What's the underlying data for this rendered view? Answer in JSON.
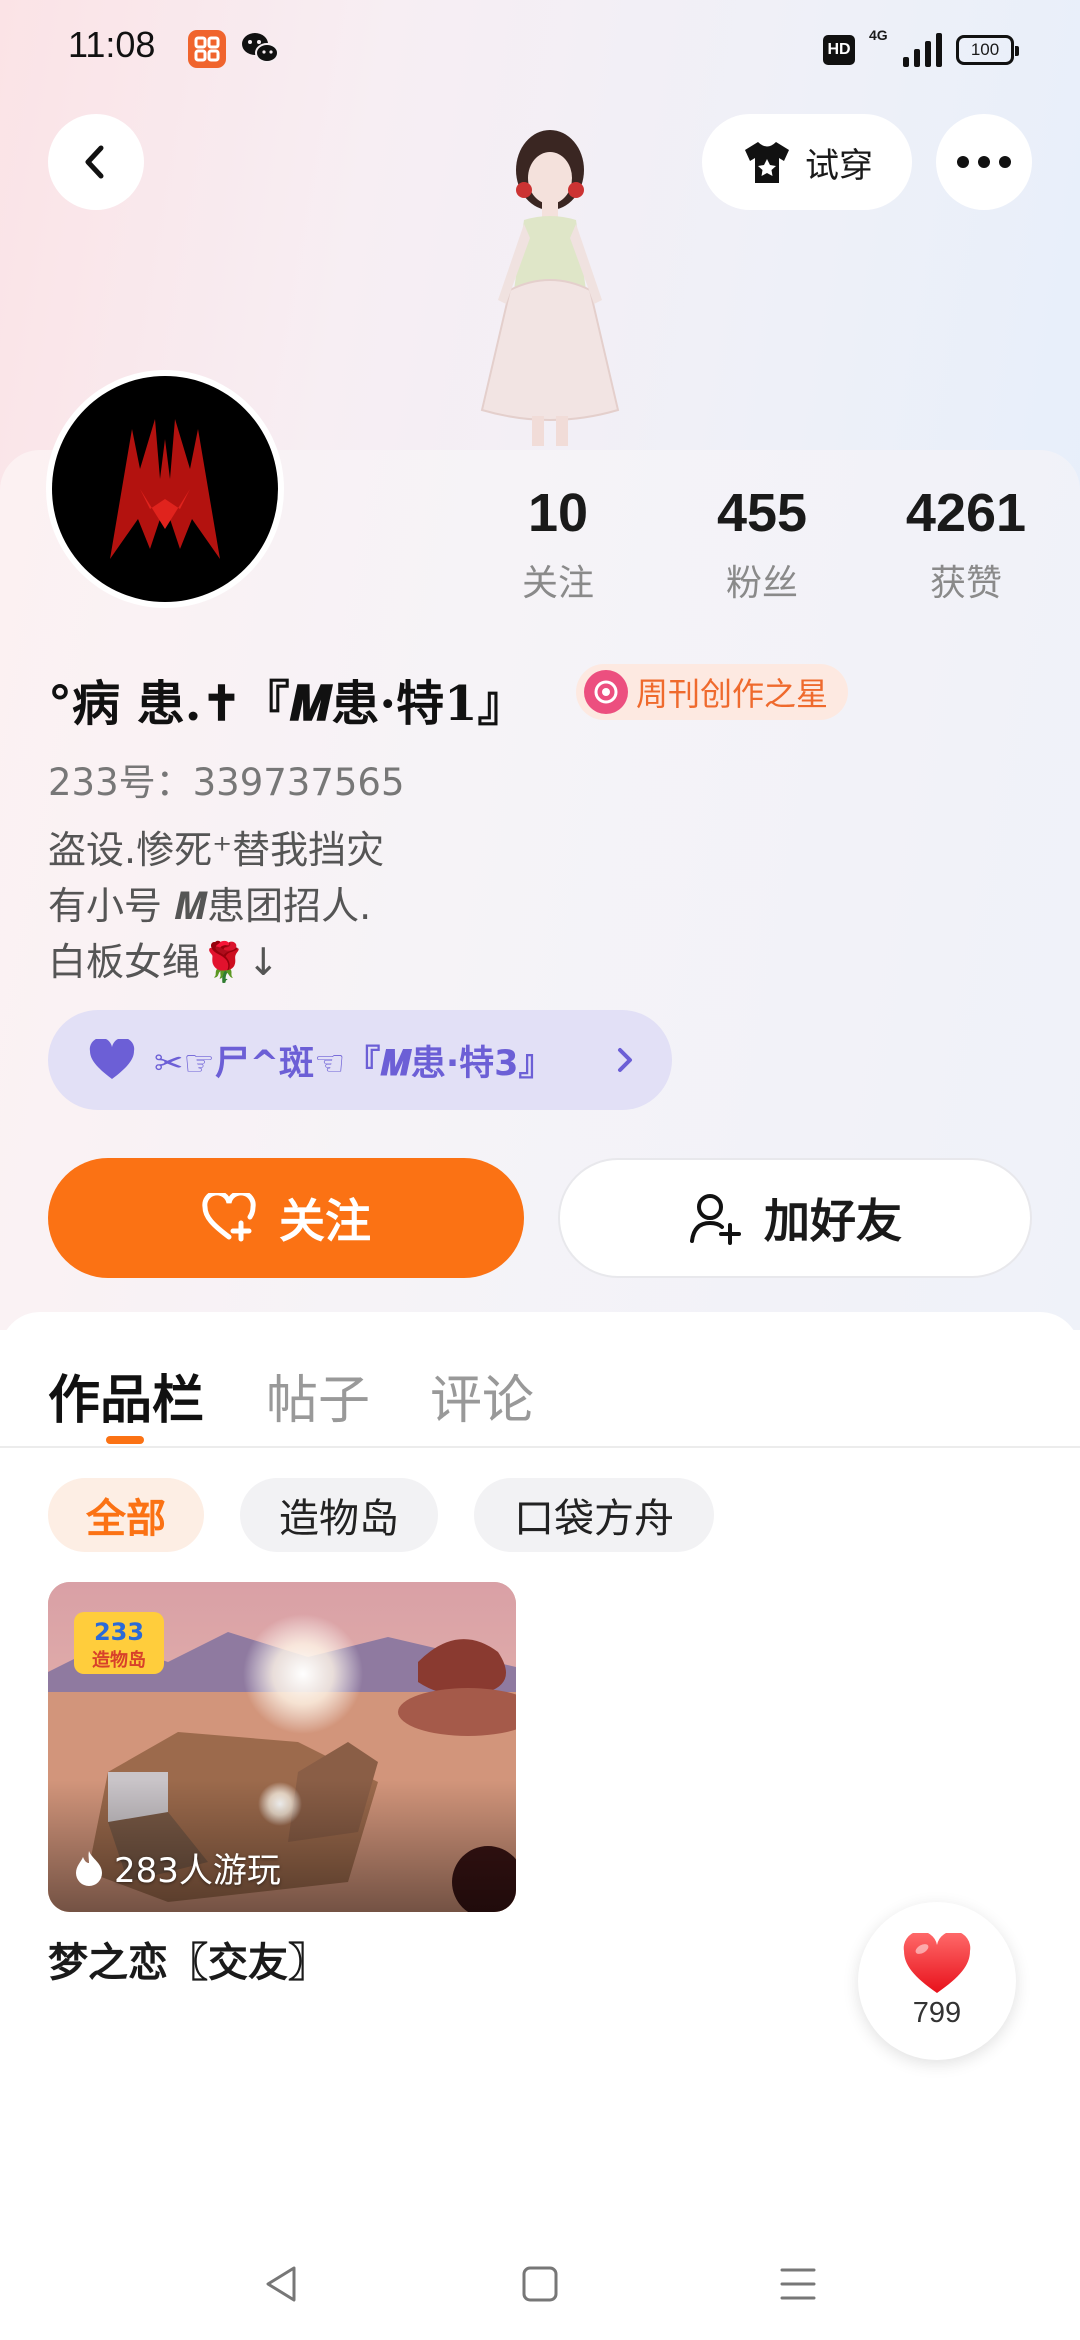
{
  "status_bar": {
    "time": "11:08",
    "hd": "HD",
    "network": "4G",
    "battery": "100"
  },
  "header": {
    "tryon_label": "试穿"
  },
  "stats": [
    {
      "value": "10",
      "label": "关注"
    },
    {
      "value": "455",
      "label": "粉丝"
    },
    {
      "value": "4261",
      "label": "获赞"
    }
  ],
  "profile": {
    "nickname": "°病 患.✝『𝑴患·特1』",
    "badge": "周刊创作之星",
    "user_id": "233号：339737565",
    "bio": "盗设.惨死⁺替我挡灾\n有小号 𝑴患团招人.\n白板女绳🌹↓",
    "pin_tag": "✂☞尸^斑☜『𝑴患·特3』"
  },
  "actions": {
    "follow_label": "关注",
    "add_friend_label": "加好友"
  },
  "tabs": [
    "作品栏",
    "帖子",
    "评论"
  ],
  "filters": [
    "全部",
    "造物岛",
    "口袋方舟"
  ],
  "works": [
    {
      "players": "283人游玩",
      "title": "梦之恋〖交友〗"
    }
  ],
  "like_fab": {
    "count": "799"
  },
  "colors": {
    "accent": "#fb7214",
    "pin_tag_text": "#6c5fd6",
    "badge_text": "#ef6a2d"
  },
  "icons": {
    "back": "chevron-left-icon",
    "tryon": "tshirt-icon",
    "more": "more-horizontal-icon",
    "follow": "heart-plus-icon",
    "add_friend": "user-plus-icon",
    "like": "heart-icon",
    "players": "flame-icon"
  }
}
